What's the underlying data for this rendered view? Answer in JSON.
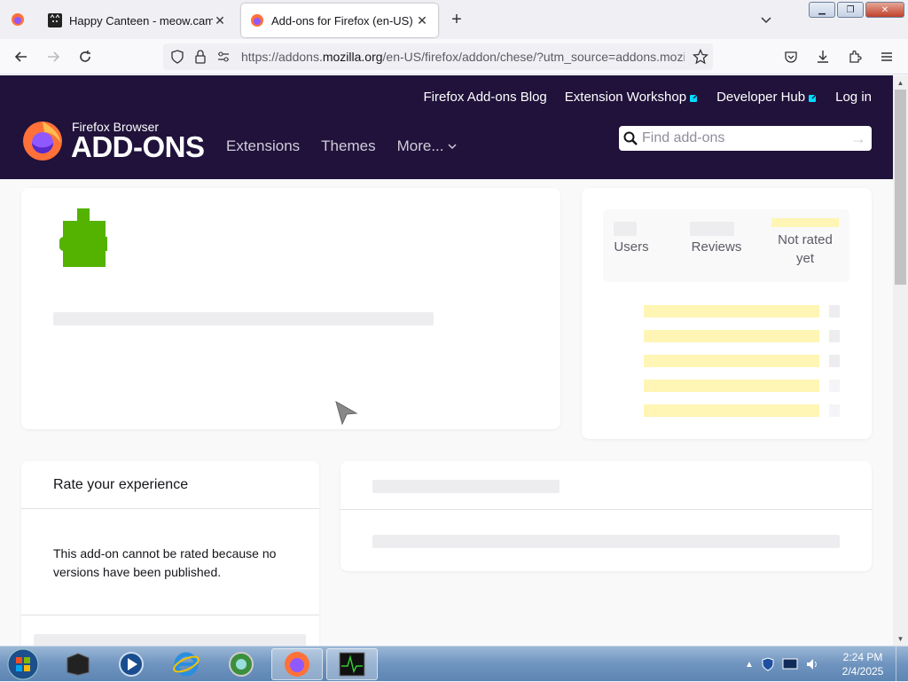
{
  "tabs": [
    {
      "title": "Happy Canteen - meow.camera",
      "active": false
    },
    {
      "title": "Add-ons for Firefox (en-US)",
      "active": true
    }
  ],
  "nav": {
    "url_prefix": "https://addons.",
    "url_domain": "mozilla.org",
    "url_rest": "/en-US/firefox/addon/chese/?utm_source=addons.mozil"
  },
  "header": {
    "links": [
      {
        "label": "Firefox Add-ons Blog",
        "external": false
      },
      {
        "label": "Extension Workshop",
        "external": true
      },
      {
        "label": "Developer Hub",
        "external": true
      },
      {
        "label": "Log in",
        "external": false
      }
    ],
    "logo_top": "Firefox Browser",
    "logo_main": "ADD-ONS",
    "menu": [
      "Extensions",
      "Themes",
      "More..."
    ],
    "search_placeholder": "Find add-ons"
  },
  "stats": {
    "users_label": "Users",
    "reviews_label": "Reviews",
    "rating_label": "Not rated yet"
  },
  "rate": {
    "heading": "Rate your experience",
    "message": "This add-on cannot be rated because no versions have been published."
  },
  "taskbar": {
    "time": "2:24 PM",
    "date": "2/4/2025"
  },
  "colors": {
    "header_bg": "#20123a",
    "puzzle_green": "#54b200",
    "rating_yellow": "#fff5b4"
  }
}
